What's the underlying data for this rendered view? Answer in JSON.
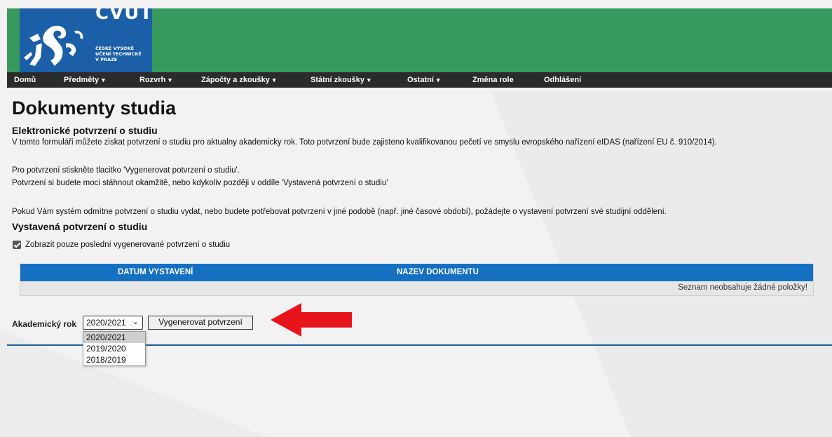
{
  "logo": {
    "title": "CVUT",
    "sub": [
      "ČESKÉ VYSOKÉ",
      "UČENÍ TECHNICKÉ",
      "V PRAZE"
    ]
  },
  "nav": [
    {
      "label": "Domů",
      "caret": false
    },
    {
      "label": "Předměty",
      "caret": true
    },
    {
      "label": "Rozvrh",
      "caret": true
    },
    {
      "label": "Zápočty a zkoušky",
      "caret": true
    },
    {
      "label": "Státní zkoušky",
      "caret": true
    },
    {
      "label": "Ostatní",
      "caret": true
    },
    {
      "label": "Změna role",
      "caret": false
    },
    {
      "label": "Odhlášení",
      "caret": false
    }
  ],
  "page_title": "Dokumenty studia",
  "section1": {
    "title": "Elektronické potvrzení o studiu",
    "intro": "V tomto formuláři můžete ziskat potvrzení o studiu pro aktualny akademicky rok. Toto potvrzení bude zajisteno kvalifikovanou pečetí ve smyslu evropského nařízení eIDAS (nařízení EU č. 910/2014).",
    "instr1": "Pro potvrzení stiskněte tlacitko 'Vygenerovat potvrzení o studiu'.",
    "instr2": "Potvrzení si budete moci stáhnout okamžitě, nebo kdykoliv později v oddíle 'Vystavená potvrzení o studiu'",
    "note": "Pokud Vám systém odmítne potvrzení o studiu vydat, nebo budete potřebovat potvrzení v jiné podobě (např. jiné časové období), požádejte o vystavení potvrzení své studijní oddělení."
  },
  "section2": {
    "title": "Vystavená potvrzení o studiu",
    "checkbox_label": "Zobrazit pouze poslední vygenerované potvrzení o studiu",
    "checkbox_checked": true
  },
  "table": {
    "col1": "DATUM VYSTAVENÍ",
    "col2": "NAZEV DOKUMENTU",
    "empty": "Seznam neobsahuje žádné položky!"
  },
  "form": {
    "label": "Akademický rok",
    "selected": "2020/2021",
    "options": [
      "2020/2021",
      "2019/2020",
      "2018/2019"
    ],
    "button": "Vygenerovat potvrzení"
  },
  "colors": {
    "header_green": "#389a5e",
    "logo_blue": "#1a5fa8",
    "nav_dark": "#2b2b2b",
    "table_blue": "#1570c2",
    "arrow_red": "#e8141c"
  },
  "icons": {
    "logo": "lion-emblem-icon",
    "arrow": "red-arrow-icon"
  }
}
